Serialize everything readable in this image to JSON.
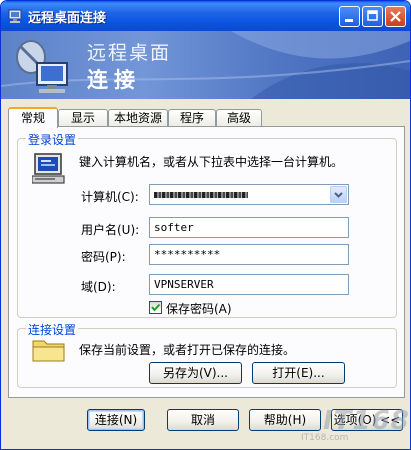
{
  "window": {
    "title": "远程桌面连接",
    "icon": "remote-desktop-icon"
  },
  "titlebar_buttons": {
    "minimize": "minimize-icon",
    "maximize": "maximize-icon",
    "close": "close-icon"
  },
  "banner": {
    "line1": "远程桌面",
    "line2": "连接"
  },
  "tabs": [
    {
      "label": "常规",
      "active": true
    },
    {
      "label": "显示",
      "active": false
    },
    {
      "label": "本地资源",
      "active": false
    },
    {
      "label": "程序",
      "active": false
    },
    {
      "label": "高级",
      "active": false
    }
  ],
  "login": {
    "legend": "登录设置",
    "instruction": "键入计算机名，或者从下拉表中选择一台计算机。",
    "computer_label": "计算机(C):",
    "computer_value": "",
    "username_label": "用户名(U):",
    "username_value": "softer",
    "password_label": "密码(P):",
    "password_value": "**********",
    "domain_label": "域(D):",
    "domain_value": "VPNSERVER",
    "save_password_label": "保存密码(A)",
    "save_password_checked": true
  },
  "connection": {
    "legend": "连接设置",
    "text": "保存当前设置，或者打开已保存的连接。",
    "save_as_label": "另存为(V)...",
    "open_label": "打开(E)..."
  },
  "footer": {
    "connect_label": "连接(N)",
    "cancel_label": "取消",
    "help_label": "帮助(H)",
    "options_label": "选项(O) <<"
  },
  "watermark": {
    "brand": "IT168",
    "sub": "IT168.com"
  },
  "colors": {
    "titlebar": "#0a5ae8",
    "legend": "#0046d5",
    "face": "#ece9d8",
    "active_tab_accent": "#f5a91f"
  }
}
